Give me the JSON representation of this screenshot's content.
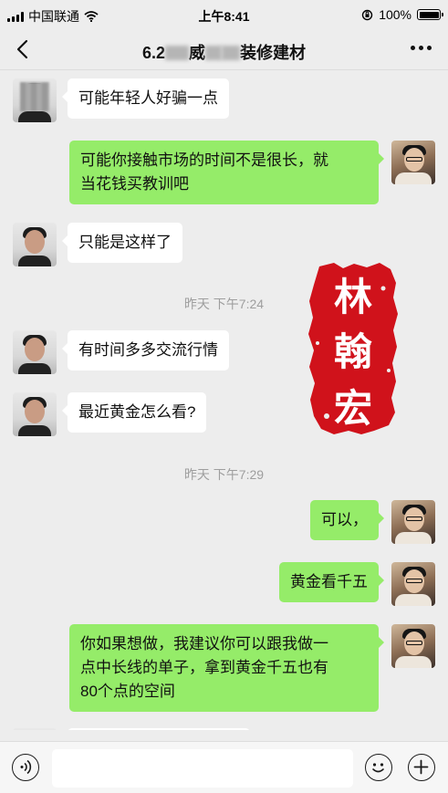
{
  "status_bar": {
    "carrier": "中国联通",
    "time": "上午8:41",
    "battery": "100%",
    "battery_level": 1.0
  },
  "nav": {
    "title_prefix": "6.2",
    "title_mid": "威",
    "title_suffix": "装修建材"
  },
  "messages": [
    {
      "side": "friend",
      "text": "可能年轻人好骗一点"
    },
    {
      "side": "me",
      "lines": [
        "可能你接触市场的时间不是很长，就",
        "当花钱买教训吧"
      ]
    },
    {
      "side": "friend",
      "text": "只能是这样了"
    },
    {
      "side": "friend",
      "text": "有时间多多交流行情"
    },
    {
      "side": "friend",
      "text": "最近黄金怎么看?"
    },
    {
      "side": "me",
      "text": "可以，"
    },
    {
      "side": "me",
      "text": "黄金看千五"
    },
    {
      "side": "me",
      "lines": [
        "你如果想做，我建议你可以跟我做一",
        "点中长线的单子，拿到黄金千五也有",
        "80个点的空间"
      ]
    }
  ],
  "timestamps": [
    "昨天 下午7:24",
    "昨天 下午7:29"
  ],
  "seal": {
    "chars": [
      "林",
      "翰",
      "宏"
    ],
    "color": "#d0121b"
  },
  "colors": {
    "my_bubble": "#95ec69",
    "friend_bubble": "#ffffff",
    "background": "#ededed"
  },
  "icons": {
    "back": "chevron-left-icon",
    "more": "more-icon",
    "voice": "voice-icon",
    "emoji": "emoji-icon",
    "plus": "plus-icon"
  }
}
